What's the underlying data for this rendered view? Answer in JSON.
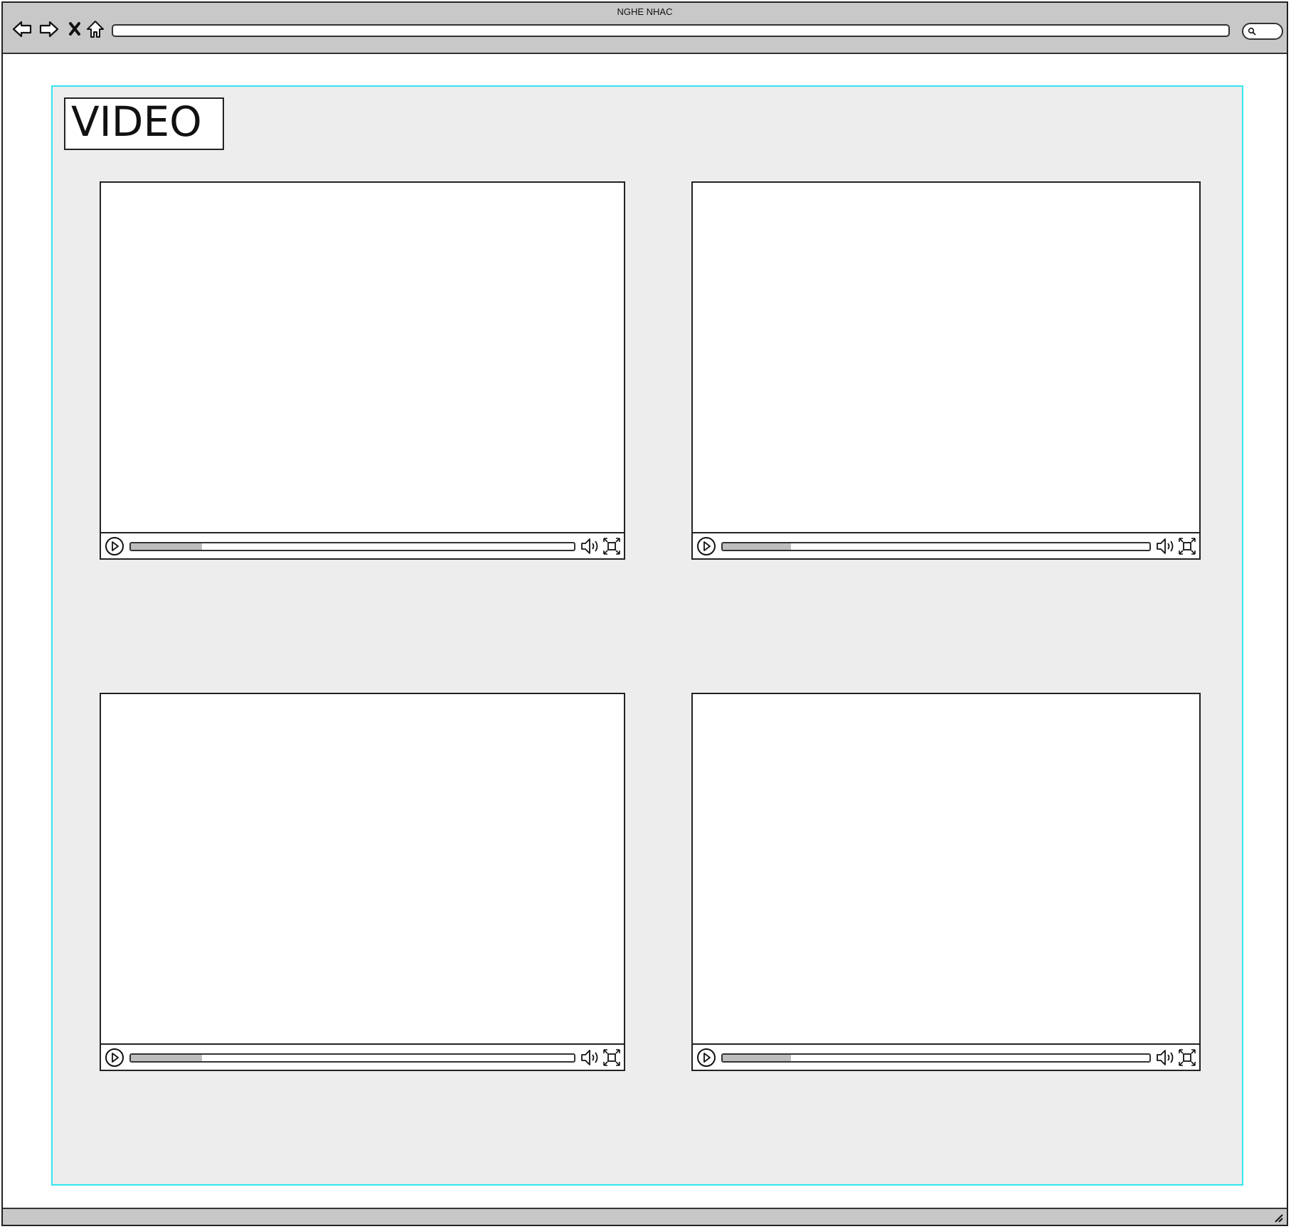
{
  "window": {
    "title": "NGHE NHAC",
    "url": "",
    "search_placeholder": ""
  },
  "toolbar": {
    "icons": [
      "back-arrow-icon",
      "forward-arrow-icon",
      "close-x-icon",
      "home-icon",
      "search-icon"
    ]
  },
  "section": {
    "title": "VIDEO"
  },
  "videos": [
    {
      "progress": 0.16,
      "controls": [
        "play-icon",
        "volume-icon",
        "fullscreen-icon"
      ]
    },
    {
      "progress": 0.16,
      "controls": [
        "play-icon",
        "volume-icon",
        "fullscreen-icon"
      ]
    },
    {
      "progress": 0.16,
      "controls": [
        "play-icon",
        "volume-icon",
        "fullscreen-icon"
      ]
    },
    {
      "progress": 0.16,
      "controls": [
        "play-icon",
        "volume-icon",
        "fullscreen-icon"
      ]
    }
  ],
  "colors": {
    "chrome": "#c8c8c8",
    "panel": "#ededed",
    "panel_border": "#33e6ee",
    "progress_fill": "#bdbdbd"
  }
}
